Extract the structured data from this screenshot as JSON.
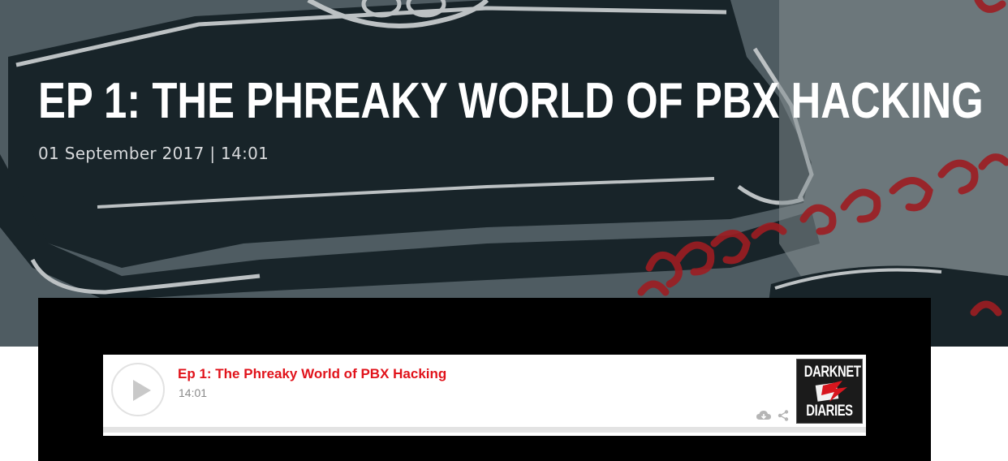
{
  "episode": {
    "title": "Ep 1: The Phreaky World of PBX Hacking",
    "title_display": "EP 1: THE PHREAKY WORLD OF PBX HACKING",
    "date": "01 September 2017",
    "separator": "|",
    "duration": "14:01",
    "meta_text": "01 September 2017 | 14:01"
  },
  "player": {
    "track_title": "Ep 1: The Phreaky World of PBX Hacking",
    "track_duration": "14:01",
    "progress": 0,
    "accent_color": "#e1131b",
    "icons": [
      "play-icon",
      "cloud-download-icon",
      "share-icon"
    ],
    "logo": {
      "line1": "DARKNET",
      "line2": "DIARIES"
    }
  },
  "colors": {
    "hero_background": "#56646b",
    "title_text": "#ffffff",
    "meta_text": "#d7d9db",
    "player_frame": "#000000",
    "player_background": "#ffffff",
    "accent": "#e1131b"
  }
}
